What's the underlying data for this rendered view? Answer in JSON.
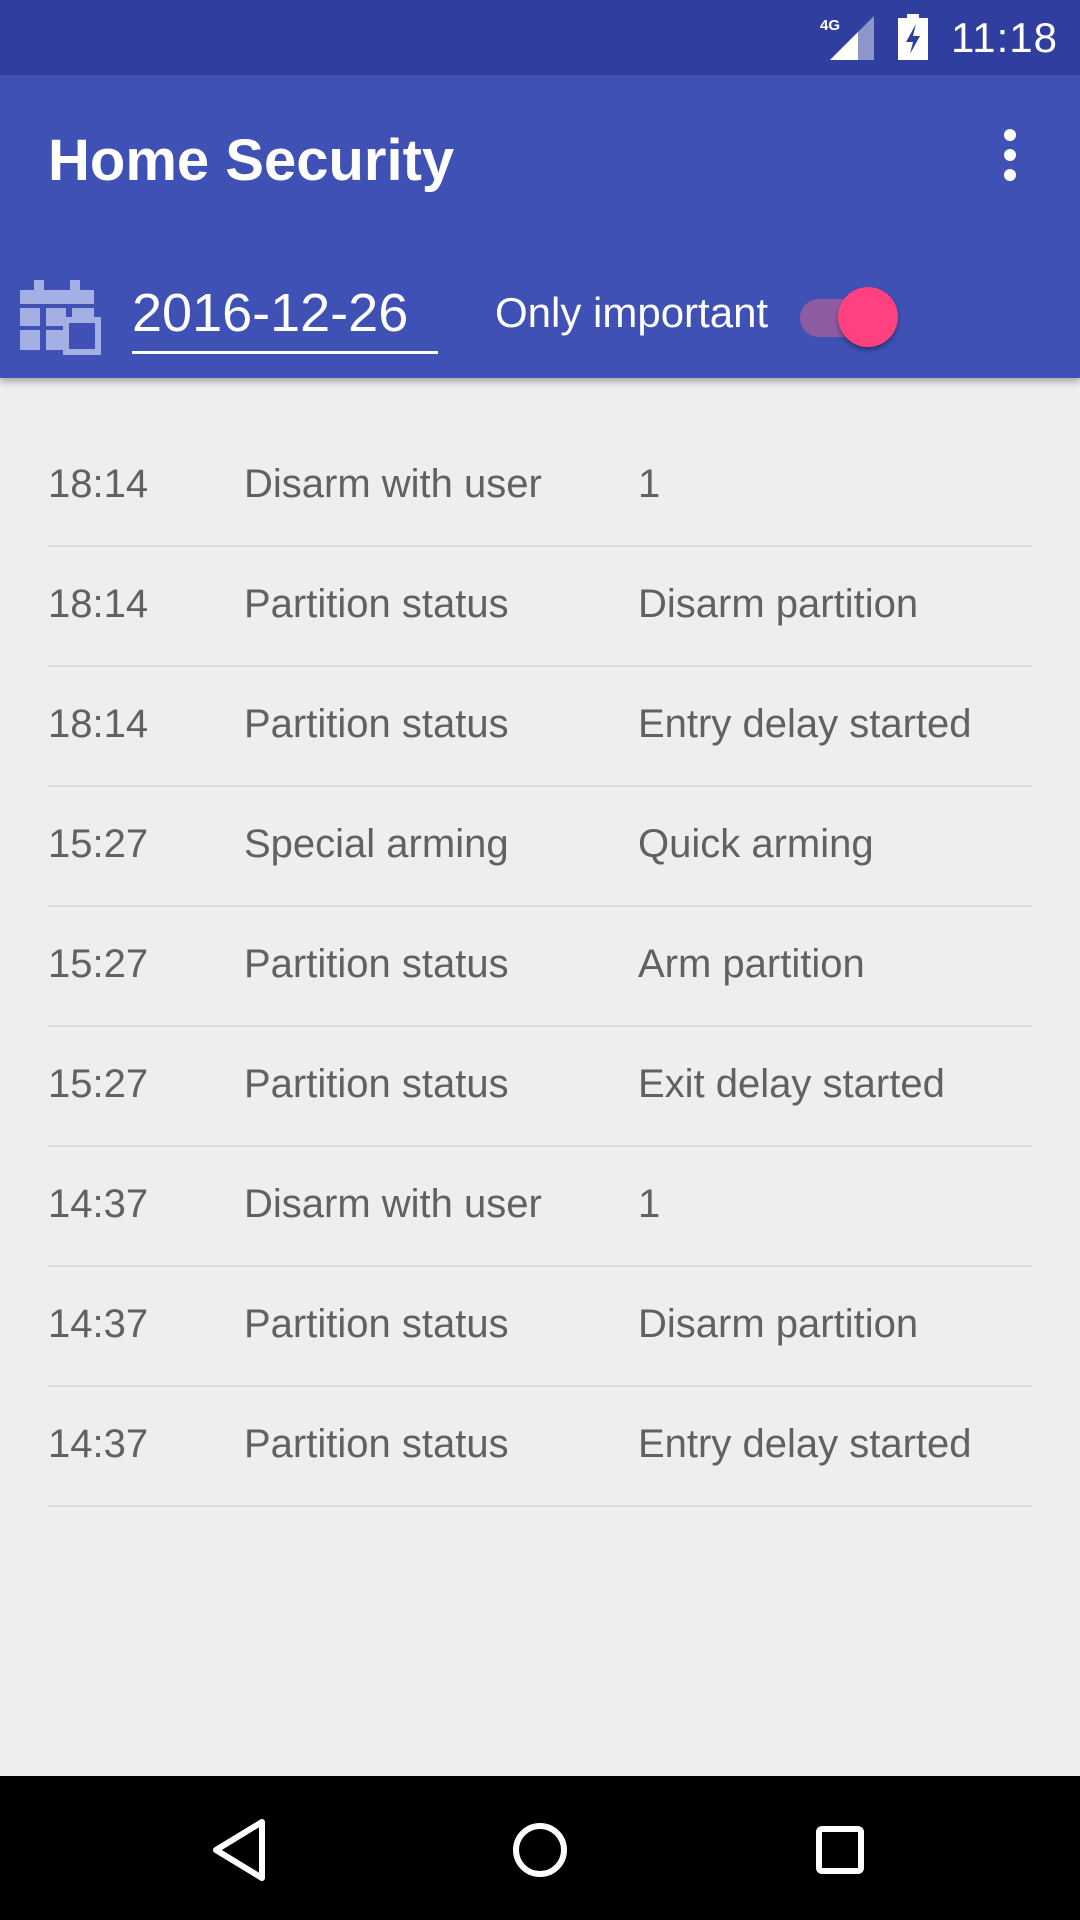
{
  "status_bar": {
    "network": "4G",
    "time": "11:18"
  },
  "app_bar": {
    "title": "Home Security",
    "menu_icon": "more-vert-icon"
  },
  "filter": {
    "calendar_icon": "calendar-icon",
    "date": "2016-12-26",
    "only_important_label": "Only important",
    "only_important_on": true
  },
  "events": [
    {
      "time": "18:14",
      "type": "Disarm with user",
      "detail": "1"
    },
    {
      "time": "18:14",
      "type": "Partition status",
      "detail": "Disarm partition"
    },
    {
      "time": "18:14",
      "type": "Partition status",
      "detail": "Entry delay started"
    },
    {
      "time": "15:27",
      "type": "Special arming",
      "detail": "Quick arming"
    },
    {
      "time": "15:27",
      "type": "Partition status",
      "detail": "Arm partition"
    },
    {
      "time": "15:27",
      "type": "Partition status",
      "detail": "Exit delay started"
    },
    {
      "time": "14:37",
      "type": "Disarm with user",
      "detail": "1"
    },
    {
      "time": "14:37",
      "type": "Partition status",
      "detail": "Disarm partition"
    },
    {
      "time": "14:37",
      "type": "Partition status",
      "detail": "Entry delay started"
    }
  ],
  "nav_bar": {
    "back_icon": "back-triangle-icon",
    "home_icon": "home-circle-icon",
    "recents_icon": "recents-square-icon"
  },
  "colors": {
    "status_bar": "#303f9f",
    "primary": "#3f51b5",
    "accent": "#ff4081",
    "background": "#eeeeee"
  }
}
